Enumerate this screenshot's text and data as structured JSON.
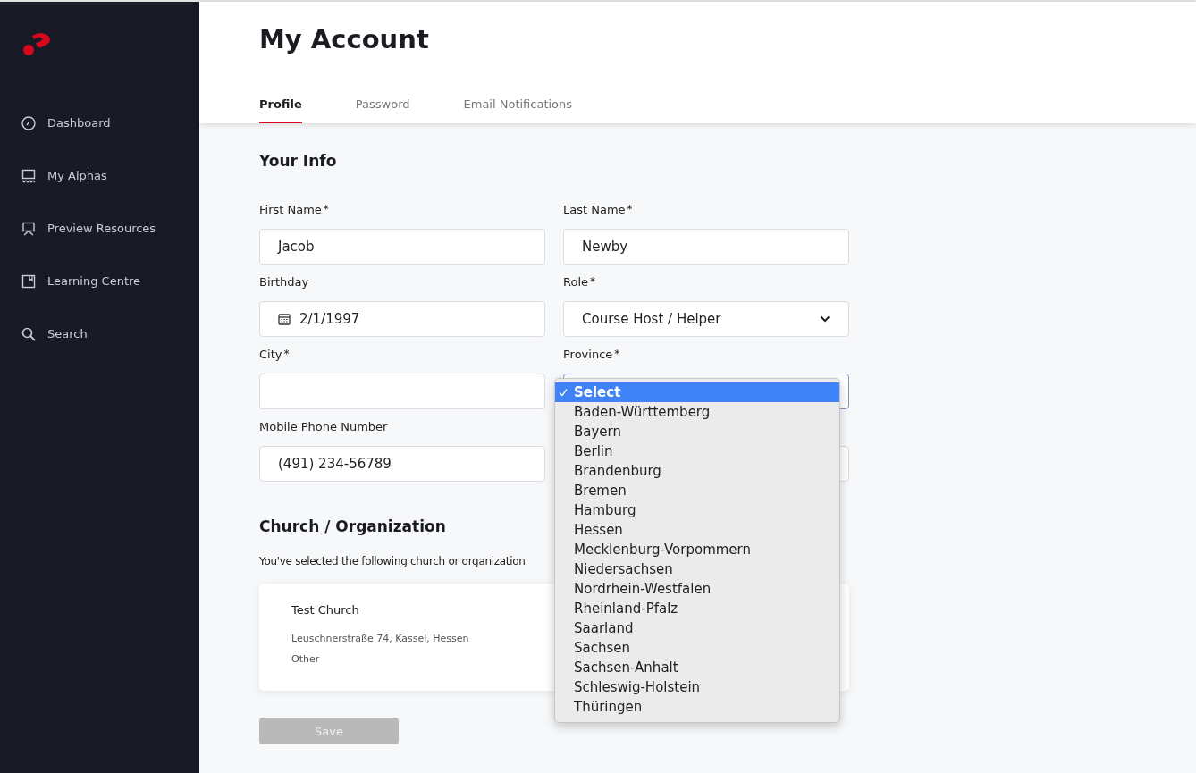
{
  "sidebar": {
    "items": [
      {
        "label": "Dashboard",
        "selected": false
      },
      {
        "label": "My Alphas",
        "selected": false
      },
      {
        "label": "Preview Resources",
        "selected": false
      },
      {
        "label": "Learning Centre",
        "selected": false
      },
      {
        "label": "Search",
        "selected": false
      }
    ]
  },
  "page_title": "My Account",
  "tabs": [
    {
      "label": "Profile",
      "selected": true
    },
    {
      "label": "Password",
      "selected": false
    },
    {
      "label": "Email Notifications",
      "selected": false
    }
  ],
  "your_info": {
    "heading": "Your Info",
    "fields": [
      {
        "label": "First Name",
        "required_mark": "*",
        "kind": "text",
        "value": "Jacob"
      },
      {
        "label": "Last Name",
        "required_mark": "*",
        "kind": "text",
        "value": "Newby"
      },
      {
        "label": "Birthday",
        "kind": "date",
        "value": "2/1/1997"
      },
      {
        "label": "Role",
        "required_mark": "*",
        "kind": "select",
        "value": "Course Host / Helper"
      },
      {
        "label": "City",
        "required_mark": "*",
        "kind": "text"
      },
      {
        "label": "Province",
        "required_mark": "*",
        "kind": "open-select"
      },
      {
        "label": "Mobile Phone Number",
        "kind": "text",
        "value": "(491) 234-56789"
      },
      {
        "kind": "hidden"
      }
    ]
  },
  "province_menu": {
    "options": [
      {
        "label": "Select",
        "selected": true
      },
      {
        "label": "Baden-Württemberg",
        "selected": false
      },
      {
        "label": "Bayern",
        "selected": false
      },
      {
        "label": "Berlin",
        "selected": false
      },
      {
        "label": "Brandenburg",
        "selected": false
      },
      {
        "label": "Bremen",
        "selected": false
      },
      {
        "label": "Hamburg",
        "selected": false
      },
      {
        "label": "Hessen",
        "selected": false
      },
      {
        "label": "Mecklenburg-Vorpommern",
        "selected": false
      },
      {
        "label": "Niedersachsen",
        "selected": false
      },
      {
        "label": "Nordrhein-Westfalen",
        "selected": false
      },
      {
        "label": "Rheinland-Pfalz",
        "selected": false
      },
      {
        "label": "Saarland",
        "selected": false
      },
      {
        "label": "Sachsen",
        "selected": false
      },
      {
        "label": "Sachsen-Anhalt",
        "selected": false
      },
      {
        "label": "Schleswig-Holstein",
        "selected": false
      },
      {
        "label": "Thüringen",
        "selected": false
      }
    ]
  },
  "church": {
    "heading": "Church / Organization",
    "description": "You've selected the following church or organization",
    "card": {
      "name": "Test Church",
      "address": "Leuschnerstraße 74, Kassel, Hessen",
      "type": "Other"
    }
  },
  "save_button": {
    "label": "Save",
    "disabled": true
  }
}
